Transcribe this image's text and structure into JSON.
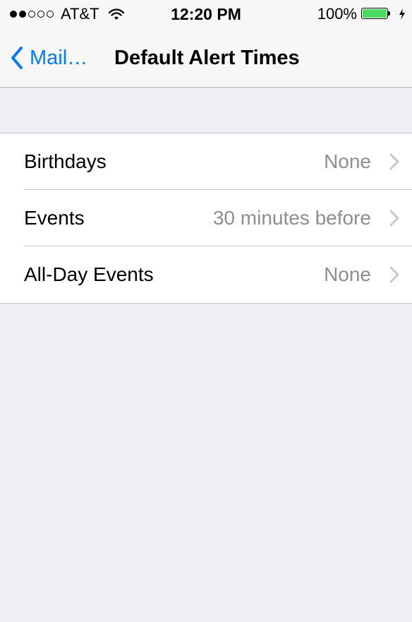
{
  "status_bar": {
    "signal_dots": [
      "full",
      "full",
      "empty",
      "empty",
      "empty"
    ],
    "carrier": "AT&T",
    "time": "12:20 PM",
    "battery_percent": "100%",
    "wifi_icon": "wifi-icon",
    "battery_icon": "battery-icon",
    "charging_icon": "charging-icon"
  },
  "nav": {
    "back_label": "Mail…",
    "title": "Default Alert Times",
    "back_icon": "chevron-left-icon"
  },
  "settings": {
    "rows": [
      {
        "label": "Birthdays",
        "value": "None"
      },
      {
        "label": "Events",
        "value": "30 minutes before"
      },
      {
        "label": "All-Day Events",
        "value": "None"
      }
    ]
  },
  "colors": {
    "accent": "#007aff",
    "battery_fill": "#4cd964",
    "background": "#efeff4",
    "secondary_text": "#8e8e93"
  }
}
